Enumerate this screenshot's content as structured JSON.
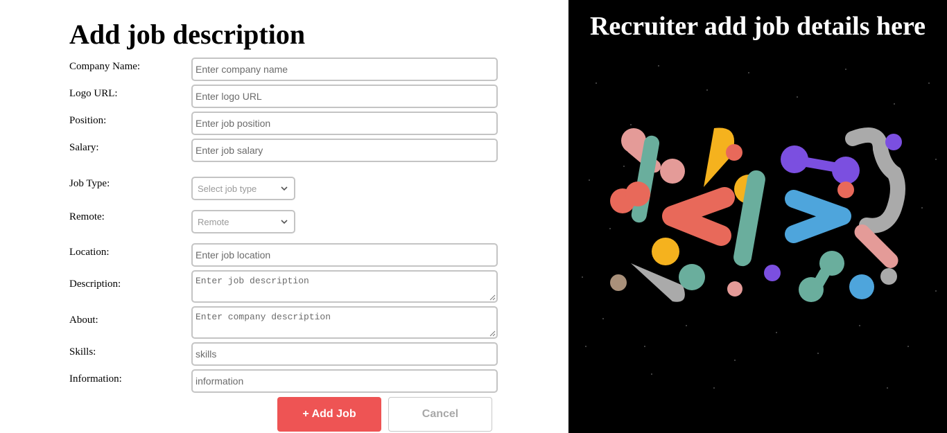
{
  "form": {
    "title": "Add job description",
    "fields": {
      "company_name": {
        "label": "Company Name:",
        "placeholder": "Enter company name"
      },
      "logo_url": {
        "label": "Logo URL:",
        "placeholder": "Enter logo URL"
      },
      "position": {
        "label": "Position:",
        "placeholder": "Enter job position"
      },
      "salary": {
        "label": "Salary:",
        "placeholder": "Enter job salary"
      },
      "job_type": {
        "label": "Job Type:",
        "selected": "Select job type"
      },
      "remote": {
        "label": "Remote:",
        "selected": "Remote"
      },
      "location": {
        "label": "Location:",
        "placeholder": "Enter job location"
      },
      "description": {
        "label": "Description:",
        "placeholder": "Enter job description"
      },
      "about": {
        "label": "About:",
        "placeholder": "Enter company description"
      },
      "skills": {
        "label": "Skills:",
        "placeholder": "skills"
      },
      "information": {
        "label": "Information:",
        "placeholder": "information"
      }
    },
    "buttons": {
      "add_label": "+ Add Job",
      "cancel_label": "Cancel"
    }
  },
  "side_panel": {
    "title": "Recruiter add job details here",
    "illustration_icon": "code-brackets-illustration"
  },
  "colors": {
    "add_button": "#ee5454",
    "panel_background": "#000000",
    "input_border": "#c4c4c4"
  }
}
